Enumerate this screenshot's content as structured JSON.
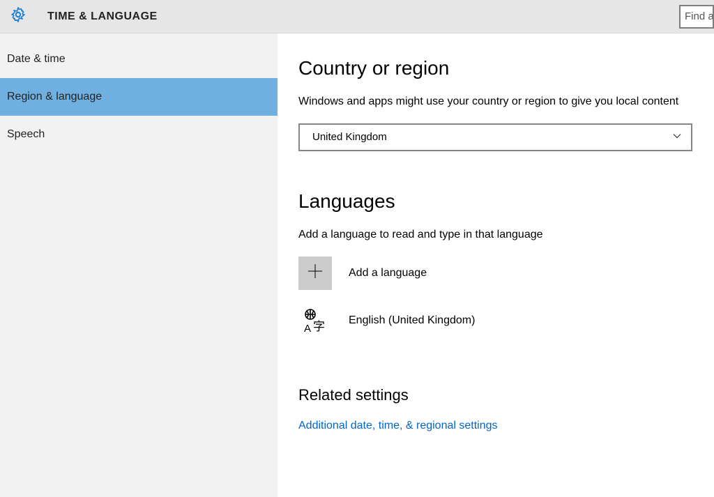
{
  "header": {
    "title": "TIME & LANGUAGE",
    "search_placeholder": "Find a"
  },
  "sidebar": {
    "items": [
      {
        "label": "Date & time",
        "selected": false
      },
      {
        "label": "Region & language",
        "selected": true
      },
      {
        "label": "Speech",
        "selected": false
      }
    ]
  },
  "content": {
    "region": {
      "title": "Country or region",
      "desc": "Windows and apps might use your country or region to give you local content",
      "selected": "United Kingdom"
    },
    "languages": {
      "title": "Languages",
      "desc": "Add a language to read and type in that language",
      "add_label": "Add a language",
      "items": [
        {
          "label": "English (United Kingdom)"
        }
      ]
    },
    "related": {
      "title": "Related settings",
      "link": "Additional date, time, & regional settings"
    }
  },
  "colors": {
    "accent": "#70b0e0",
    "gear": "#1f7fd4",
    "link": "#0066cc"
  }
}
